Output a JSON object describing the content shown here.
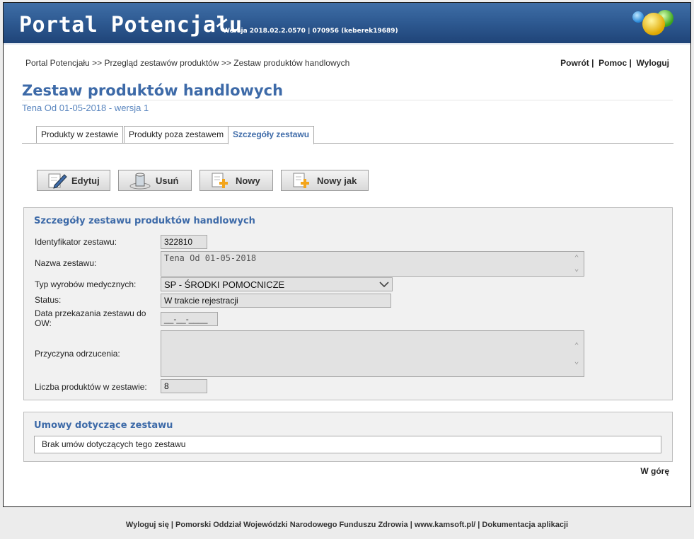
{
  "header": {
    "title": "Portal Potencjału",
    "version": "Wersja 2018.02.2.0570 | 070956 (keberek19689)"
  },
  "breadcrumb": {
    "item1": "Portal Potencjału",
    "sep": ">>",
    "item2": "Przegląd zestawów produktów",
    "item3": "Zestaw produktów handlowych"
  },
  "toplinks": {
    "back": "Powrót",
    "help": "Pomoc",
    "logout": "Wyloguj",
    "sep": "|"
  },
  "page": {
    "title": "Zestaw produktów handlowych",
    "subtitle": "Tena Od 01-05-2018 - wersja 1"
  },
  "tabs": [
    "Produkty w zestawie",
    "Produkty poza zestawem",
    "Szczegóły zestawu"
  ],
  "active_tab": "Szczegóły zestawu",
  "toolbar": {
    "edit": "Edytuj",
    "delete": "Usuń",
    "new": "Nowy",
    "new_like": "Nowy jak"
  },
  "details": {
    "section_title": "Szczegóły zestawu produktów handlowych",
    "id_label": "Identyfikator zestawu:",
    "id_value": "322810",
    "name_label": "Nazwa zestawu:",
    "name_value": "Tena Od 01-05-2018",
    "type_label": "Typ wyrobów medycznych:",
    "type_value": "SP - ŚRODKI POMOCNICZE",
    "status_label": "Status:",
    "status_value": "W trakcie rejestracji",
    "date_label": "Data przekazania zestawu do OW:",
    "date_value": "__-__-____",
    "reject_label": "Przyczyna odrzucenia:",
    "reject_value": "",
    "count_label": "Liczba produktów w zestawie:",
    "count_value": "8"
  },
  "contracts": {
    "section_title": "Umowy dotyczące zestawu",
    "empty_text": "Brak umów dotyczących tego zestawu"
  },
  "gotop": "W górę",
  "footer": {
    "logout": "Wyloguj się",
    "org": "Pomorski Oddział Wojewódzki Narodowego Funduszu Zdrowia",
    "site": "www.kamsoft.pl/",
    "docs": "Dokumentacja aplikacji",
    "sep": "|"
  },
  "colors": {
    "header": "#2f5b93",
    "accent": "#3d6aa8",
    "panel": "#f1f1f1"
  },
  "icons": [
    "pencil-icon",
    "trash-icon",
    "new-document-icon",
    "new-document-copy-icon",
    "logo-orbs-icon",
    "chevron-down-icon"
  ]
}
